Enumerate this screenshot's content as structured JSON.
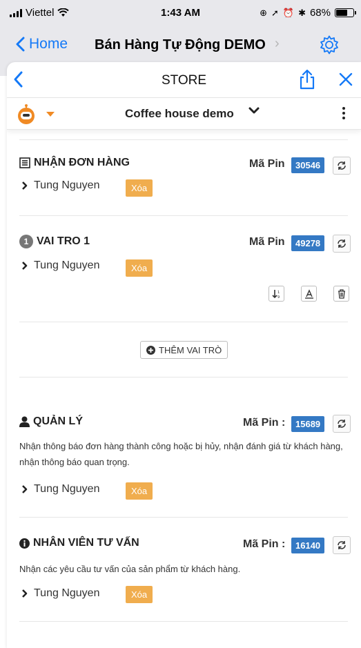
{
  "status_bar": {
    "carrier": "Viettel",
    "time": "1:43 AM",
    "battery": "68%",
    "battery_level": 0.68
  },
  "ios_nav": {
    "back_label": "Home",
    "title": "Bán Hàng Tự Động DEMO",
    "settings_icon": "gear-icon"
  },
  "sheet_nav": {
    "title": "STORE",
    "back_icon": "chevron-left-icon",
    "share_icon": "share-icon",
    "close_icon": "close-icon"
  },
  "store_bar": {
    "store_name": "Coffee house demo",
    "avatar_icon": "robot-icon",
    "menu_icon": "kebab-icon"
  },
  "sections": {
    "order_receiver": {
      "title": "NHẬN ĐƠN HÀNG",
      "pin_label": "Mã Pin",
      "pin": "30546",
      "user": "Tung Nguyen",
      "delete_label": "Xóa"
    },
    "role1": {
      "number": "1",
      "title": "VAI TRO 1",
      "pin_label": "Mã Pin",
      "pin": "49278",
      "user": "Tung Nguyen",
      "delete_label": "Xóa"
    },
    "add_role_label": "THÊM VAI TRÒ",
    "manager": {
      "title": "QUẢN LÝ",
      "pin_label": "Mã Pin :",
      "pin": "15689",
      "description": "Nhận thông báo đơn hàng thành công hoặc bị hủy, nhận đánh giá từ khách hàng, nhận thông báo quan trọng.",
      "user": "Tung Nguyen",
      "delete_label": "Xóa"
    },
    "consultant": {
      "title": "NHÂN VIÊN TƯ VẤN",
      "pin_label": "Mã Pin :",
      "pin": "16140",
      "description": "Nhận các yêu cầu tư vấn của sản phẩm từ khách hàng.",
      "user": "Tung Nguyen",
      "delete_label": "Xóa"
    }
  },
  "colors": {
    "ios_blue": "#1479f7",
    "pin_blue": "#3479c4",
    "delete_orange": "#f0ad4e",
    "accent_orange": "#f08a24"
  }
}
